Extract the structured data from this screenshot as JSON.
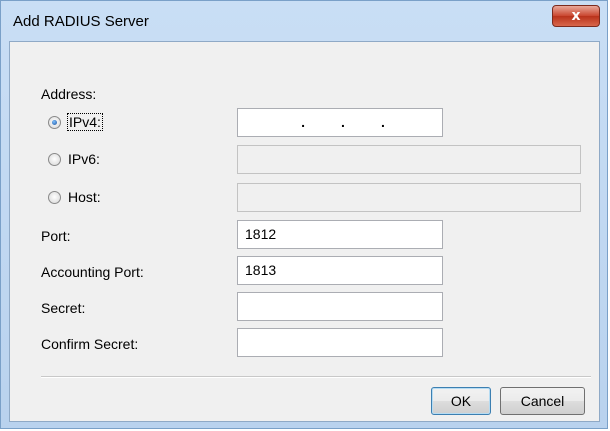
{
  "window": {
    "title": "Add RADIUS Server",
    "close_glyph": "x"
  },
  "form": {
    "address_label": "Address:",
    "address_options": [
      {
        "label": "IPv4:",
        "checked": true,
        "enabled": true
      },
      {
        "label": "IPv6:",
        "checked": false,
        "enabled": false
      },
      {
        "label": "Host:",
        "checked": false,
        "enabled": false
      }
    ],
    "ipv4_value": ". . .",
    "ipv4_dots": [
      ".",
      ".",
      "."
    ],
    "port_label": "Port:",
    "port_value": "1812",
    "accounting_port_label": "Accounting Port:",
    "accounting_port_value": "1813",
    "secret_label": "Secret:",
    "secret_value": "",
    "confirm_secret_label": "Confirm Secret:",
    "confirm_secret_value": ""
  },
  "buttons": {
    "ok_label": "OK",
    "cancel_label": "Cancel"
  },
  "colors": {
    "frame": "#c3d8f1",
    "client_background": "#f0f0f0",
    "close_button": "#c9452e"
  }
}
